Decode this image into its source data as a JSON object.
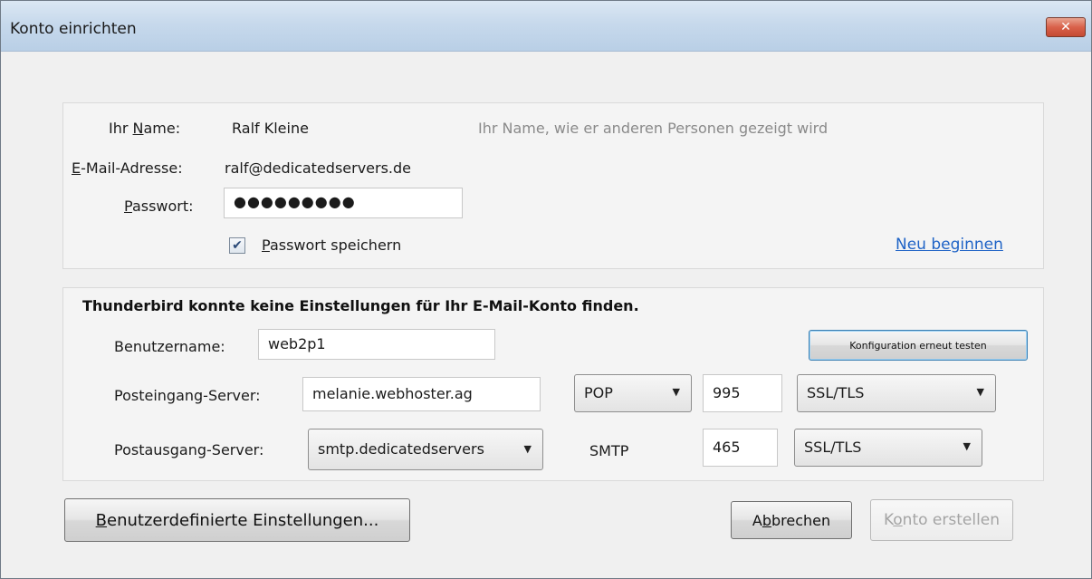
{
  "window": {
    "title": "Konto einrichten",
    "close_label": "✕"
  },
  "identity": {
    "name_label_pre": "Ihr ",
    "name_label_ul": "N",
    "name_label_post": "ame:",
    "name_value": "Ralf Kleine",
    "name_hint": "Ihr Name, wie er anderen Personen gezeigt wird",
    "email_label_ul": "E",
    "email_label_post": "-Mail-Adresse:",
    "email_value": "ralf@dedicatedservers.de",
    "password_label_ul": "P",
    "password_label_post": "asswort:",
    "password_value": "●●●●●●●●●",
    "save_password_checked": "✔",
    "save_password_label_ul": "P",
    "save_password_label_post": "asswort speichern",
    "restart_link": "Neu beginnen"
  },
  "config": {
    "message": "Thunderbird konnte keine Einstellungen für Ihr E-Mail-Konto finden.",
    "username_label": "Benutzername:",
    "username_value": "web2p1",
    "retest_button": "Konfiguration erneut testen",
    "incoming_label": "Posteingang-Server:",
    "incoming_server": "melanie.webhoster.ag",
    "incoming_protocol": "POP",
    "incoming_port": "995",
    "incoming_security": "SSL/TLS",
    "outgoing_label": "Postausgang-Server:",
    "outgoing_server": "smtp.dedicatedservers",
    "outgoing_protocol": "SMTP",
    "outgoing_port": "465",
    "outgoing_security": "SSL/TLS"
  },
  "footer": {
    "custom_settings_ul": "B",
    "custom_settings_post": "enutzerdefinierte Einstellungen...",
    "cancel_pre": "A",
    "cancel_ul": "b",
    "cancel_post": "brechen",
    "create_pre": "K",
    "create_ul": "o",
    "create_post": "nto erstellen"
  },
  "icons": {
    "close": "close-icon",
    "dropdown": "chevron-down-icon",
    "check": "checkmark-icon"
  }
}
